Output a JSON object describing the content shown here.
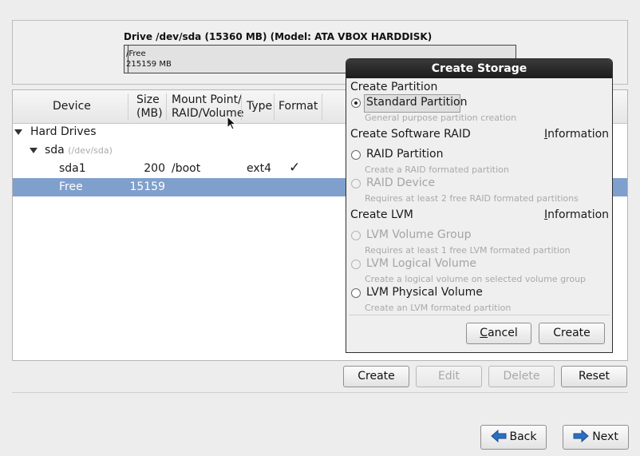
{
  "drive": {
    "title": "Drive /dev/sda (15360 MB) (Model: ATA VBOX HARDDISK)",
    "segment_line1": "Free",
    "segment_line2": "215159 MB"
  },
  "table": {
    "headers": {
      "device": "Device",
      "size_1": "Size",
      "size_2": "(MB)",
      "mount_1": "Mount Point/",
      "mount_2": "RAID/Volume",
      "type": "Type",
      "format": "Format"
    },
    "rows": [
      {
        "device": "Hard Drives"
      },
      {
        "device": "sda",
        "note": "(/dev/sda)"
      },
      {
        "device": "sda1",
        "size": "200",
        "mount": "/boot",
        "type": "ext4",
        "format": "✓"
      },
      {
        "device": "Free",
        "size": "15159",
        "mount": "",
        "type": "",
        "format": ""
      }
    ]
  },
  "actions": {
    "create": "Create",
    "edit": "Edit",
    "delete": "Delete",
    "reset": "Reset"
  },
  "nav": {
    "back": "Back",
    "next": "Next"
  },
  "dialog": {
    "title": "Create Storage",
    "section_partition": "Create Partition",
    "standard_label": "Standard Partition",
    "standard_desc": "General purpose partition creation",
    "section_raid": "Create Software RAID",
    "raid_info": "Information",
    "raid_partition_label": "RAID Partition",
    "raid_partition_desc": "Create a RAID formated partition",
    "raid_device_label": "RAID Device",
    "raid_device_desc": "Requires at least 2 free RAID formated partitions",
    "section_lvm": "Create LVM",
    "lvm_info": "Information",
    "lvm_vg_label": "LVM Volume Group",
    "lvm_vg_desc": "Requires at least 1 free LVM formated partition",
    "lvm_lv_label": "LVM Logical Volume",
    "lvm_lv_desc": "Create a logical volume on selected volume group",
    "lvm_pv_label": "LVM Physical Volume",
    "lvm_pv_desc": "Create an LVM formated partition",
    "cancel": "Cancel",
    "create": "Create"
  },
  "colors": {
    "selection": "#7fa0cc",
    "dialog_title_bg": "#1c1c1c",
    "arrow_blue": "#2a6fc4"
  }
}
